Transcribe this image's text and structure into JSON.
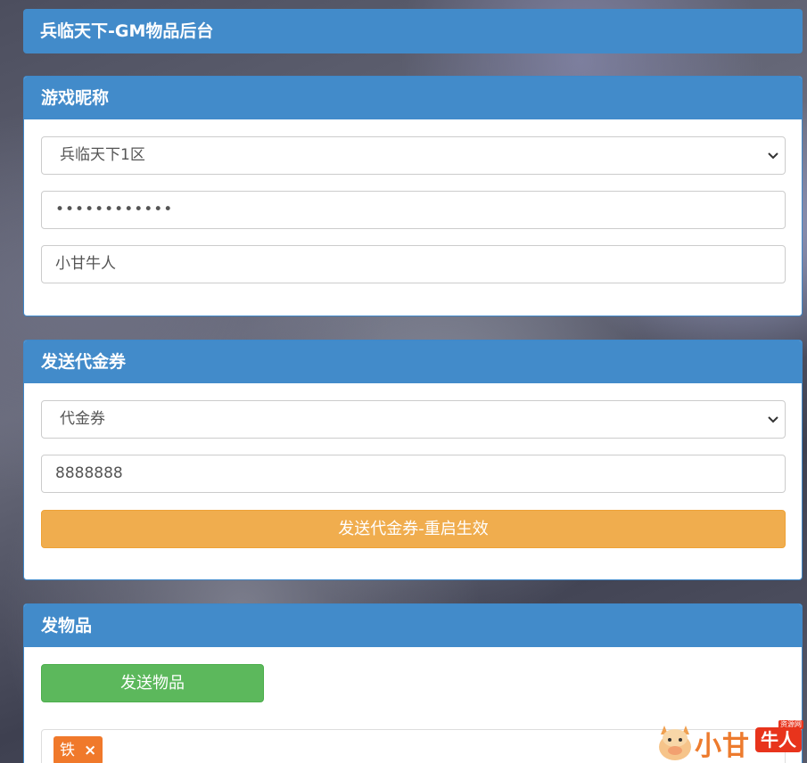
{
  "header": {
    "title": "兵临天下-GM物品后台"
  },
  "nickname_panel": {
    "title": "游戏昵称",
    "server_select": {
      "value": "兵临天下1区"
    },
    "password": {
      "value": "••••••••••••"
    },
    "nickname": {
      "value": "小甘牛人"
    }
  },
  "voucher_panel": {
    "title": "发送代金券",
    "type_select": {
      "value": "代金券"
    },
    "amount": {
      "value": "8888888"
    },
    "send_button": "发送代金券-重启生效"
  },
  "item_panel": {
    "title": "发物品",
    "send_button": "发送物品",
    "tags": [
      {
        "label": "铁",
        "remove": "×"
      }
    ]
  },
  "watermark": {
    "text": "小甘",
    "badge": "牛人",
    "small": "资源网"
  },
  "colors": {
    "primary": "#428bca",
    "warning": "#f0ad4e",
    "success": "#5cb85c",
    "tag": "#f0792b"
  },
  "icons": {
    "select_arrow": "chevron-down-icon",
    "tag_remove": "close-icon",
    "logo": "cow-mascot-icon"
  }
}
